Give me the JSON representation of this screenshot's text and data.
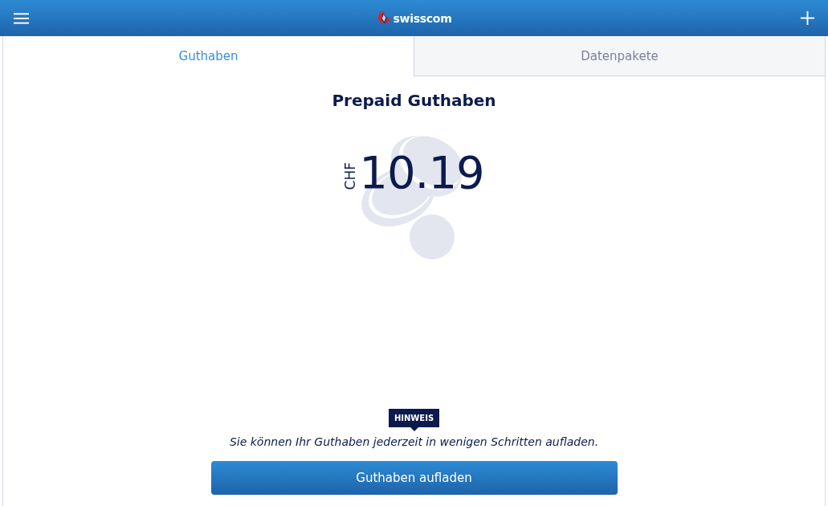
{
  "header": {
    "logo_text": "swisscom"
  },
  "tabs": [
    {
      "label": "Guthaben",
      "selected": true
    },
    {
      "label": "Datenpakete",
      "selected": false
    }
  ],
  "balance": {
    "title": "Prepaid Guthaben",
    "currency": "CHF",
    "amount": "10.19"
  },
  "hint": {
    "badge": "HINWEIS",
    "text": "Sie können Ihr Guthaben jederzeit in wenigen Schritten aufladen."
  },
  "button": {
    "label": "Guthaben aufladen"
  }
}
